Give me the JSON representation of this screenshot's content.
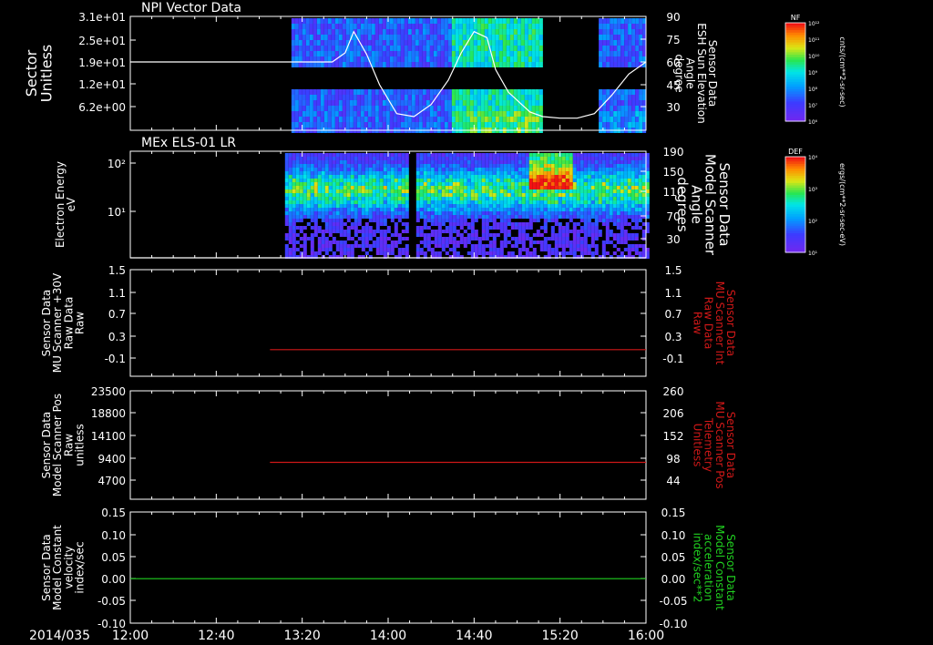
{
  "colors": {
    "background": "#000000",
    "axis": "#ffffff",
    "red_trace": "#d01818",
    "green_trace": "#20d020",
    "white_trace": "#ffffff"
  },
  "time_axis": {
    "date_label": "2014/035",
    "ticks": [
      "12:00",
      "12:40",
      "13:20",
      "14:00",
      "14:40",
      "15:20",
      "16:00"
    ],
    "range_minutes": [
      0,
      240
    ]
  },
  "colorbars": [
    {
      "tag": "NF",
      "label": "cnts/(cm**2-sr-sec)",
      "tick_labels": [
        "10¹²",
        "10¹¹",
        "10¹⁰",
        "10⁹",
        "10⁸",
        "10⁷",
        "10⁶"
      ],
      "scale": "rainbow"
    },
    {
      "tag": "DEF",
      "label": "ergs/(cm**2-sr-sec-eV)",
      "tick_labels": [
        "10⁴",
        "10³",
        "10²",
        "10¹"
      ],
      "scale": "rainbow"
    }
  ],
  "chart_data": [
    {
      "type": "heatmap",
      "title": "NPI Vector Data",
      "ylabel": "Sector\nUnitless",
      "y_tick_labels": [
        "3.1e+01",
        "2.5e+01",
        "1.9e+01",
        "1.2e+01",
        "6.2e+00"
      ],
      "ylim": [
        0,
        31
      ],
      "data_coverage_minutes": [
        [
          75,
          192
        ],
        [
          218,
          240
        ]
      ],
      "overlay": {
        "name": "Sensor Data\nESH Sun Elevation\nAngle\ndegree",
        "axis": "right",
        "y_tick_labels": [
          "90",
          "75",
          "60",
          "45",
          "30"
        ],
        "ylim": [
          15,
          90
        ],
        "x_minutes": [
          0,
          94,
          100,
          104,
          110,
          116,
          124,
          132,
          140,
          148,
          154,
          160,
          166,
          170,
          176,
          186,
          192,
          200,
          208,
          216,
          224,
          232,
          240
        ],
        "values": [
          60,
          60,
          66,
          80,
          65,
          45,
          26,
          24,
          32,
          48,
          66,
          80,
          76,
          55,
          40,
          27,
          24,
          23,
          23,
          26,
          38,
          52,
          60
        ]
      }
    },
    {
      "type": "heatmap",
      "title": "MEx ELS-01 LR",
      "ylabel": "Electron Energy\neV",
      "y_tick_labels": [
        "10²",
        "10¹"
      ],
      "yscale": "log",
      "ylim": [
        1,
        200
      ],
      "data_coverage_minutes": [
        [
          72,
          240
        ]
      ],
      "overlay": {
        "name": "Sensor Data\nModel Scanner\nAngle\ndegrees",
        "axis": "right",
        "y_tick_labels": [
          "190",
          "150",
          "110",
          "70",
          "30"
        ],
        "ylim": [
          0,
          190
        ],
        "x_minutes": [
          0,
          240
        ],
        "values": [
          0,
          0
        ]
      }
    },
    {
      "type": "line",
      "ylabel": "Sensor Data\nMU Scanner +30V\nRaw Data\nRaw",
      "y_tick_labels": [
        "1.5",
        "1.1",
        "0.7",
        "0.3",
        "-0.1"
      ],
      "ylim": [
        -0.5,
        1.5
      ],
      "right_ylabel": "Sensor Data\nMU Scanner Int\nRaw Data\nRaw",
      "right_tick_labels": [
        "1.5",
        "1.1",
        "0.7",
        "0.3",
        "-0.1"
      ],
      "series": [
        {
          "color": "#d01818",
          "x_minutes": [
            65,
            240
          ],
          "values": [
            0.0,
            0.0
          ]
        }
      ]
    },
    {
      "type": "line",
      "ylabel": "Sensor Data\nModel Scanner Pos\nRaw\nunitless",
      "y_tick_labels": [
        "23500",
        "18800",
        "14100",
        "9400",
        "4700"
      ],
      "ylim": [
        0,
        23500
      ],
      "right_ylabel": "Sensor Data\nMU Scanner Pos\nTelemetry\nUnitless",
      "right_tick_labels": [
        "260",
        "206",
        "152",
        "98",
        "44"
      ],
      "series": [
        {
          "color": "#d01818",
          "x_minutes": [
            65,
            240
          ],
          "values": [
            8000,
            8000
          ]
        }
      ]
    },
    {
      "type": "line",
      "ylabel": "Sensor Data\nModel Constant\nvelocity\nindex/sec",
      "y_tick_labels": [
        "0.15",
        "0.10",
        "0.05",
        "0.00",
        "-0.05",
        "-0.10"
      ],
      "ylim": [
        -0.1,
        0.15
      ],
      "right_ylabel": "Sensor Data\nModel Constant\nacceleration\nindex/sec**2",
      "right_tick_labels": [
        "0.15",
        "0.10",
        "0.05",
        "0.00",
        "-0.05",
        "-0.10"
      ],
      "series": [
        {
          "color": "#20d020",
          "x_minutes": [
            0,
            240
          ],
          "values": [
            0.0,
            0.0
          ]
        }
      ]
    }
  ]
}
